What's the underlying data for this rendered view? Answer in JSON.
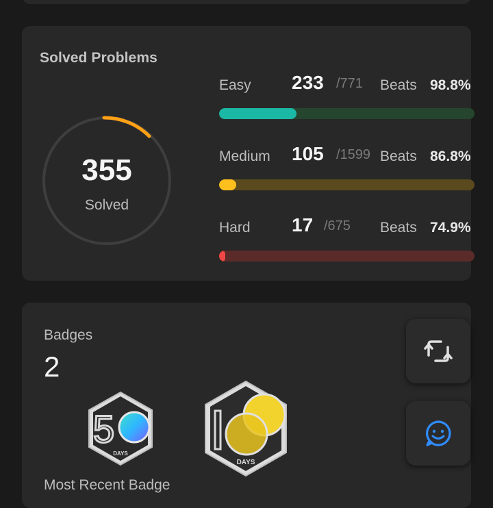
{
  "solved": {
    "title": "Solved Problems",
    "count": "355",
    "label": "Solved",
    "rows": [
      {
        "name": "Easy",
        "count": "233",
        "total": "/771",
        "beats_label": "Beats",
        "beats": "98.8%",
        "progress": 0.302,
        "fill_color": "#1cb8a6",
        "track_color": "#25452f"
      },
      {
        "name": "Medium",
        "count": "105",
        "total": "/1599",
        "beats_label": "Beats",
        "beats": "86.8%",
        "progress": 0.066,
        "fill_color": "#ffc01e",
        "track_color": "#5a4a1d"
      },
      {
        "name": "Hard",
        "count": "17",
        "total": "/675",
        "beats_label": "Beats",
        "beats": "74.9%",
        "progress": 0.025,
        "fill_color": "#ef4743",
        "track_color": "#5a2b29"
      }
    ]
  },
  "badges": {
    "title": "Badges",
    "count": "2",
    "items": [
      {
        "icon": "50-days-badge-icon",
        "digits": "50",
        "caption": "DAYS"
      },
      {
        "icon": "100-days-badge-icon",
        "digits": "100",
        "caption": "DAYS"
      }
    ],
    "recent_label": "Most Recent Badge"
  },
  "floating_buttons": [
    {
      "icon": "repeat-icon"
    },
    {
      "icon": "chat-smile-icon",
      "color": "#2f8cff"
    }
  ],
  "colors": {
    "ring_track": "#3e3e3e",
    "ring_arc": "#ffa116"
  }
}
